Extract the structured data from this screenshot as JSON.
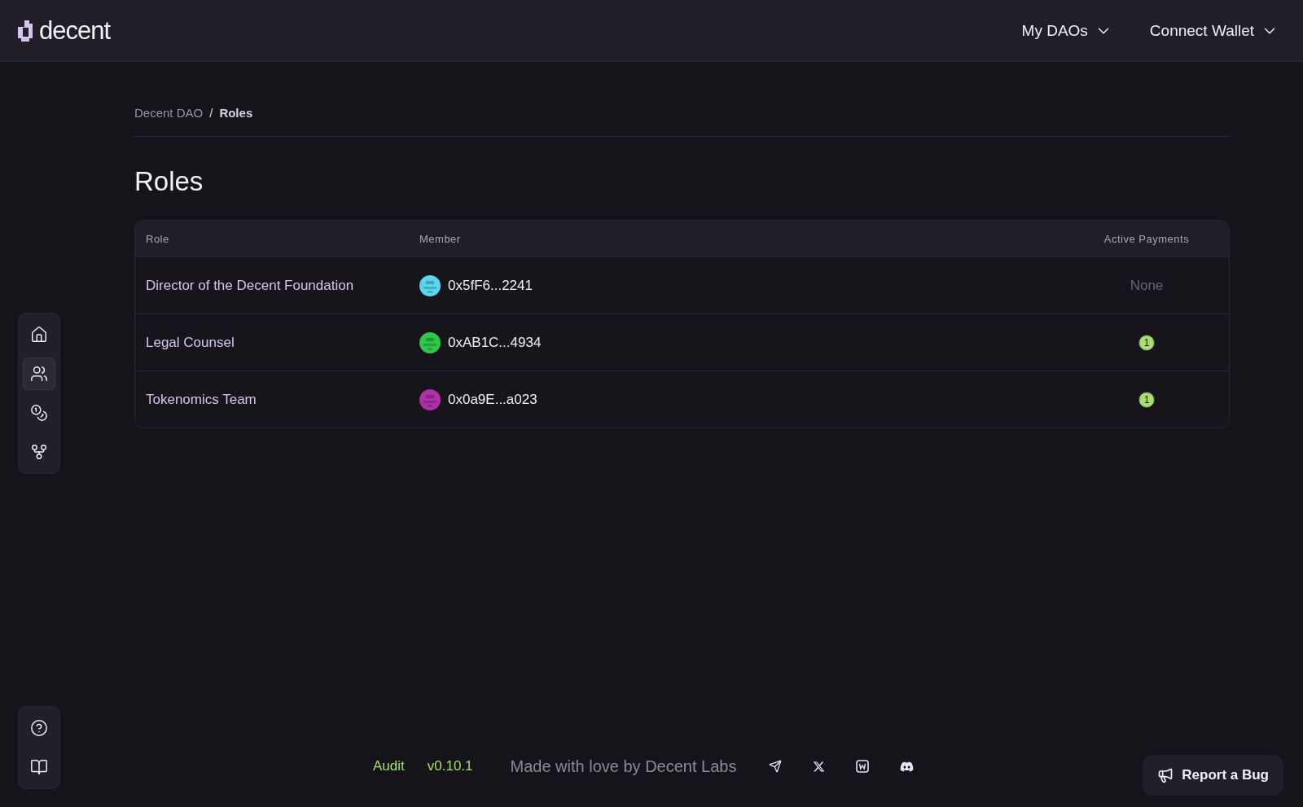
{
  "header": {
    "logo": "decent",
    "menus": [
      {
        "label": "My DAOs"
      },
      {
        "label": "Connect Wallet"
      }
    ]
  },
  "sidebar": {
    "items": [
      {
        "selected": false
      },
      {
        "selected": true
      },
      {
        "selected": false
      },
      {
        "selected": false
      }
    ]
  },
  "breadcrumb": [
    {
      "label": "Decent DAO",
      "current": false
    },
    {
      "label": "Roles",
      "current": true
    }
  ],
  "breadcrumb_separator": "/",
  "title": "Roles",
  "table": {
    "columns": [
      "Role",
      "Member",
      "Active Payments"
    ],
    "rows": [
      {
        "role": "Director of the Decent Foundation",
        "member": "0x5fF6...2241",
        "color": "#5ad7f0",
        "payments": {
          "kind": "none",
          "text": "None"
        }
      },
      {
        "role": "Legal Counsel",
        "member": "0xAB1C...4934",
        "color": "#2fc84a",
        "payments": {
          "kind": "count",
          "text": "1"
        }
      },
      {
        "role": "Tokenomics Team",
        "member": "0x0a9E...a023",
        "color": "#b02fa8",
        "payments": {
          "kind": "count",
          "text": "1"
        }
      }
    ]
  },
  "footer": {
    "links": [
      "Audit",
      "v0.10.1"
    ],
    "tagline": "Made with love by Decent Labs"
  },
  "report_button": "Report a Bug"
}
